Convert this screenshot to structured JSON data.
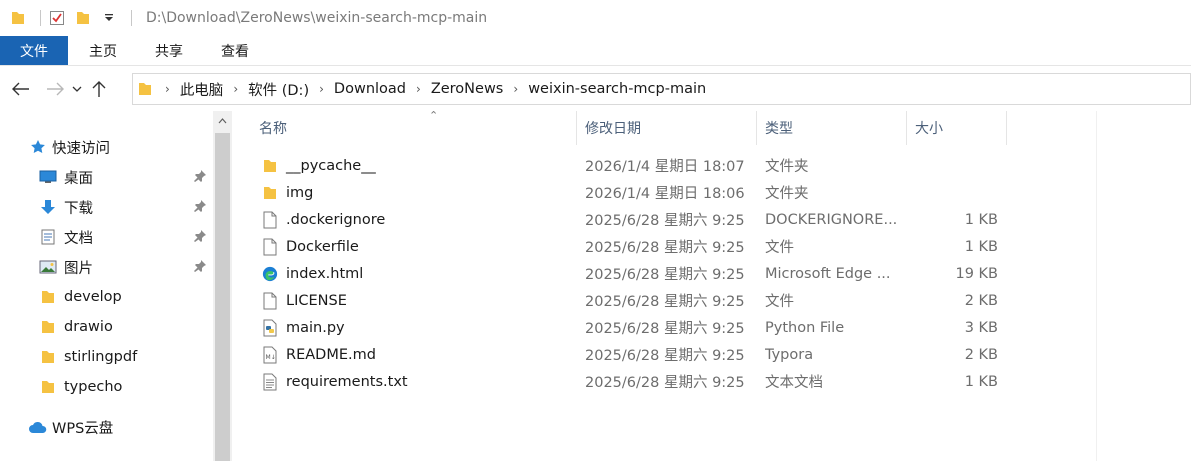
{
  "window": {
    "title": "D:\\Download\\ZeroNews\\weixin-search-mcp-main"
  },
  "ribbon": {
    "tabs": [
      "文件",
      "主页",
      "共享",
      "查看"
    ]
  },
  "address": {
    "crumbs": [
      "此电脑",
      "软件 (D:)",
      "Download",
      "ZeroNews",
      "weixin-search-mcp-main"
    ]
  },
  "nav": {
    "quick_access": "快速访问",
    "items": [
      {
        "label": "桌面",
        "icon": "desktop-icon",
        "pinned": true
      },
      {
        "label": "下载",
        "icon": "download-icon",
        "pinned": true
      },
      {
        "label": "文档",
        "icon": "document-icon",
        "pinned": true
      },
      {
        "label": "图片",
        "icon": "pictures-icon",
        "pinned": true
      },
      {
        "label": "develop",
        "icon": "folder-icon",
        "pinned": false
      },
      {
        "label": "drawio",
        "icon": "folder-icon",
        "pinned": false
      },
      {
        "label": "stirlingpdf",
        "icon": "folder-icon",
        "pinned": false
      },
      {
        "label": "typecho",
        "icon": "folder-icon",
        "pinned": false
      }
    ],
    "wps": "WPS云盘"
  },
  "columns": {
    "name": "名称",
    "date": "修改日期",
    "type": "类型",
    "size": "大小"
  },
  "files": [
    {
      "name": "__pycache__",
      "date": "2026/1/4 星期日 18:07",
      "type": "文件夹",
      "size": "",
      "icon": "folder-icon"
    },
    {
      "name": "img",
      "date": "2026/1/4 星期日 18:06",
      "type": "文件夹",
      "size": "",
      "icon": "folder-icon"
    },
    {
      "name": ".dockerignore",
      "date": "2025/6/28 星期六 9:25",
      "type": "DOCKERIGNORE...",
      "size": "1 KB",
      "icon": "file-icon"
    },
    {
      "name": "Dockerfile",
      "date": "2025/6/28 星期六 9:25",
      "type": "文件",
      "size": "1 KB",
      "icon": "file-icon"
    },
    {
      "name": "index.html",
      "date": "2025/6/28 星期六 9:25",
      "type": "Microsoft Edge ...",
      "size": "19 KB",
      "icon": "edge-icon"
    },
    {
      "name": "LICENSE",
      "date": "2025/6/28 星期六 9:25",
      "type": "文件",
      "size": "2 KB",
      "icon": "file-icon"
    },
    {
      "name": "main.py",
      "date": "2025/6/28 星期六 9:25",
      "type": "Python File",
      "size": "3 KB",
      "icon": "python-icon"
    },
    {
      "name": "README.md",
      "date": "2025/6/28 星期六 9:25",
      "type": "Typora",
      "size": "2 KB",
      "icon": "markdown-icon"
    },
    {
      "name": "requirements.txt",
      "date": "2025/6/28 星期六 9:25",
      "type": "文本文档",
      "size": "1 KB",
      "icon": "text-file-icon"
    }
  ],
  "colors": {
    "ribbon_file_tab": "#1a64b3",
    "folder": "#f5c242",
    "header_text": "#4c607a"
  }
}
